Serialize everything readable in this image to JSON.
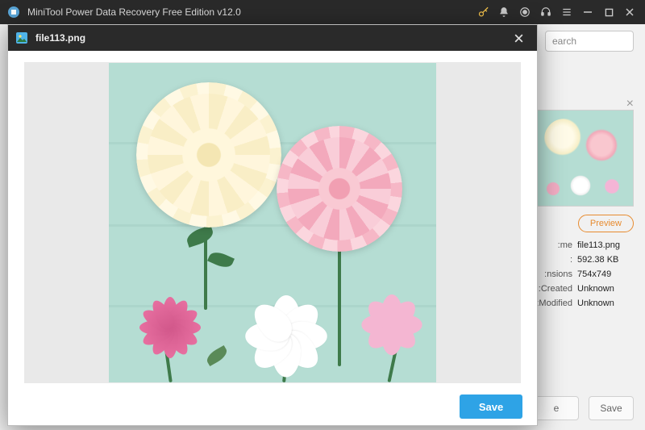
{
  "app": {
    "title": "MiniTool Power Data Recovery Free Edition v12.0"
  },
  "titlebar_icons": {
    "key": "key-icon",
    "bell": "bell-icon",
    "target": "target-icon",
    "headset": "headset-icon",
    "menu": "menu-icon",
    "minimize": "minimize-icon",
    "maximize": "maximize-icon",
    "close": "close-icon"
  },
  "search": {
    "placeholder": "earch"
  },
  "sidepanel": {
    "preview_label": "Preview",
    "rows": {
      "name_label": "me:",
      "name_value": "file113.png",
      "size_label": ":",
      "size_value": "592.38 KB",
      "dim_label": "nsions:",
      "dim_value": "754x749",
      "created_label": "Created:",
      "created_value": "Unknown",
      "modified_label": "Modified:",
      "modified_value": "Unknown"
    }
  },
  "bottom": {
    "left_btn": "e",
    "right_btn": "Save"
  },
  "modal": {
    "filename": "file113.png",
    "save_label": "Save"
  }
}
